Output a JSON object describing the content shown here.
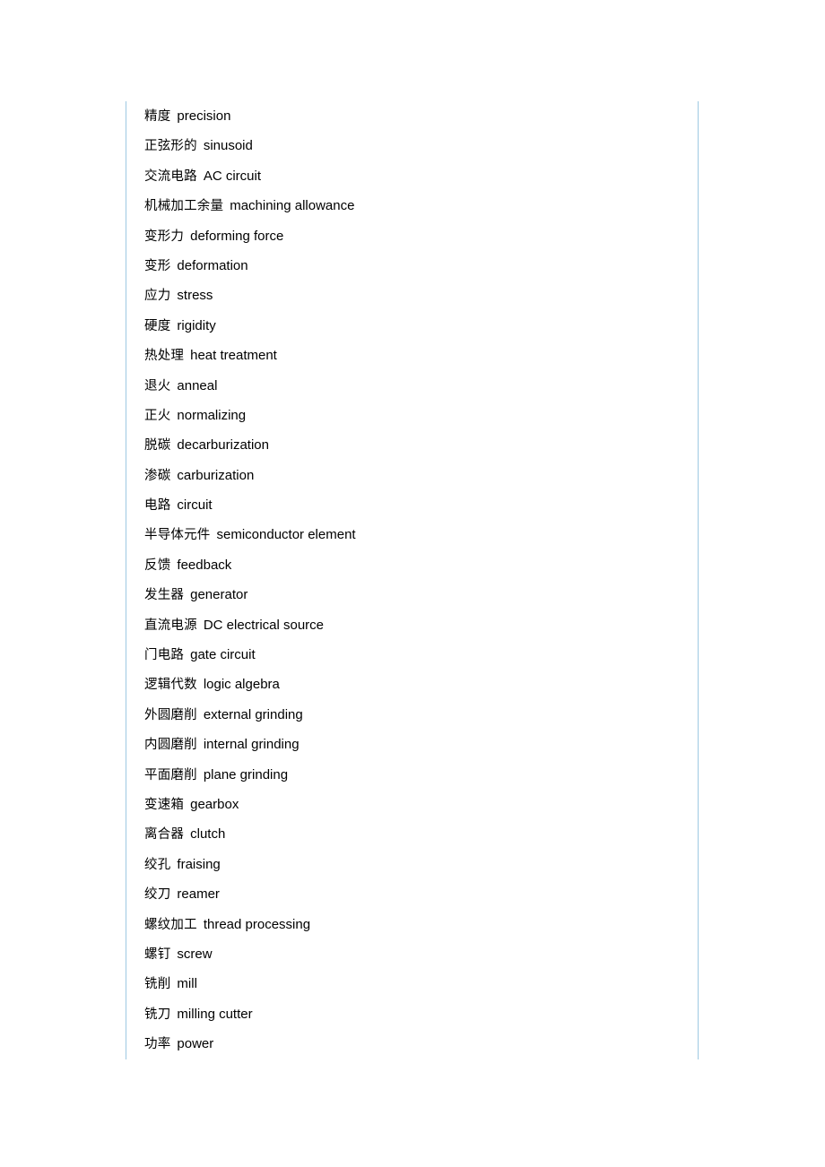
{
  "page": {
    "background_color": "#ffffff",
    "text_color": "#000000",
    "border_color": "#9ec9e2"
  },
  "glossary": {
    "entries": [
      {
        "zh": "精度",
        "en": "precision"
      },
      {
        "zh": "正弦形的",
        "en": "sinusoid"
      },
      {
        "zh": "交流电路",
        "en": "AC circuit"
      },
      {
        "zh": "机械加工余量",
        "en": "machining allowance"
      },
      {
        "zh": "变形力",
        "en": "deforming force"
      },
      {
        "zh": "变形",
        "en": "deformation"
      },
      {
        "zh": "应力",
        "en": "stress"
      },
      {
        "zh": "硬度",
        "en": "rigidity"
      },
      {
        "zh": "热处理",
        "en": "heat treatment"
      },
      {
        "zh": "退火",
        "en": "anneal"
      },
      {
        "zh": "正火",
        "en": "normalizing"
      },
      {
        "zh": "脱碳",
        "en": "decarburization"
      },
      {
        "zh": "渗碳",
        "en": "carburization"
      },
      {
        "zh": "电路",
        "en": "circuit"
      },
      {
        "zh": "半导体元件",
        "en": "semiconductor element"
      },
      {
        "zh": "反馈",
        "en": "feedback"
      },
      {
        "zh": "发生器",
        "en": "generator"
      },
      {
        "zh": "直流电源",
        "en": "DC electrical source"
      },
      {
        "zh": "门电路",
        "en": "gate circuit"
      },
      {
        "zh": "逻辑代数",
        "en": "logic algebra"
      },
      {
        "zh": "外圆磨削",
        "en": "external grinding"
      },
      {
        "zh": "内圆磨削",
        "en": "internal grinding"
      },
      {
        "zh": "平面磨削",
        "en": "plane grinding"
      },
      {
        "zh": "变速箱",
        "en": "gearbox"
      },
      {
        "zh": "离合器",
        "en": "clutch"
      },
      {
        "zh": "绞孔",
        "en": "fraising"
      },
      {
        "zh": "绞刀",
        "en": "reamer"
      },
      {
        "zh": "螺纹加工",
        "en": "thread processing"
      },
      {
        "zh": "螺钉",
        "en": "screw"
      },
      {
        "zh": "铣削",
        "en": "mill"
      },
      {
        "zh": "铣刀",
        "en": "milling cutter"
      },
      {
        "zh": "功率",
        "en": "power"
      }
    ]
  }
}
